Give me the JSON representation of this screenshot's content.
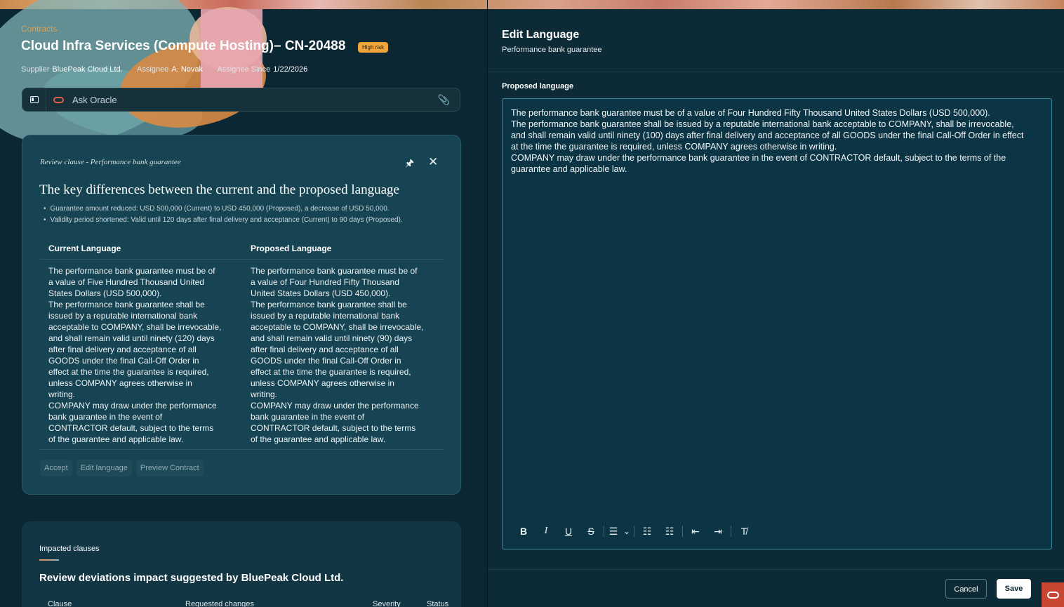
{
  "colors": {
    "accent_orange": "#f0a43c",
    "oracle_red": "#c74634",
    "panel_bg": "#0d2b36"
  },
  "contract": {
    "breadcrumb": "Contracts",
    "title": "Cloud Infra Services (Compute Hosting)– CN-20488",
    "risk_badge": "High risk",
    "supplier_label": "Supplier",
    "supplier_value": "BluePeak Cloud Ltd.",
    "assignee_label": "Assignee",
    "assignee_value": "A. Novak",
    "since_label": "Assignee Since",
    "since_value": "1/22/2026"
  },
  "ask": {
    "placeholder": "Ask Oracle",
    "panel_icon": "panel-toggle-icon",
    "clip_icon": "paperclip-icon"
  },
  "review": {
    "subtitle": "Review clause - Performance bank guarantee",
    "heading": "The key differences between the current and the proposed language",
    "bullets": [
      "Guarantee amount reduced: USD 500,000 (Current) to USD 450,000 (Proposed), a decrease of USD 50,000.",
      "Validity period shortened: Valid until 120 days after final delivery and acceptance (Current) to 90 days (Proposed)."
    ],
    "current_header": "Current Language",
    "proposed_header": "Proposed Language",
    "current_text": "The performance bank guarantee must be of\na value of Five Hundred Thousand United\nStates Dollars (USD 500,000).\nThe performance bank guarantee shall be\nissued by a reputable international bank\nacceptable to COMPANY, shall be irrevocable,\nand shall remain valid until ninety (120) days\nafter final delivery and acceptance of all\nGOODS under the final Call-Off Order in\neffect at the time the guarantee is required,\nunless COMPANY agrees otherwise in\nwriting.\nCOMPANY may draw under the performance\nbank guarantee in the event of\nCONTRACTOR default, subject to the terms\nof the guarantee and applicable law.",
    "proposed_text": "The performance bank guarantee must be of\na value of Four Hundred Fifty Thousand\nUnited States Dollars (USD 450,000).\nThe performance bank guarantee shall be\nissued by a reputable international bank\nacceptable to COMPANY, shall be irrevocable,\nand shall remain valid until ninety (90) days\nafter final delivery and acceptance of all\nGOODS under the final Call-Off Order in\neffect at the time the guarantee is required,\nunless COMPANY agrees otherwise in\nwriting.\nCOMPANY may draw under the performance\nbank guarantee in the event of\nCONTRACTOR default, subject to the terms\nof the guarantee and applicable law.",
    "actions": [
      "Accept",
      "Edit language",
      "Preview Contract"
    ]
  },
  "impacted": {
    "label": "Impacted clauses",
    "heading": "Review deviations impact suggested by BluePeak Cloud Ltd.",
    "columns": [
      "Clause",
      "Requested changes",
      "Severity",
      "Status"
    ]
  },
  "edit": {
    "title": "Edit Language",
    "subtitle": "Performance bank guarantee",
    "field_label": "Proposed language",
    "text": "The performance bank guarantee must be of a value of Four Hundred Fifty Thousand United States Dollars (USD 500,000).\nThe performance bank guarantee shall be issued by a reputable international bank acceptable to COMPANY, shall be irrevocable,\nand shall remain valid until ninety (100) days after final delivery and acceptance of all GOODS under the final Call-Off Order in effect\nat the time the guarantee is required, unless COMPANY agrees otherwise in writing.\nCOMPANY may draw under the performance bank guarantee in the event of CONTRACTOR default, subject to the terms of the\nguarantee and applicable law.",
    "toolbar": {
      "bold": "B",
      "italic": "I",
      "underline": "U",
      "strike": "S",
      "align": "☰",
      "dropdown": "⌄",
      "bullets": "☷",
      "numbered": "☷",
      "outdent": "⇤",
      "indent": "⇥",
      "clear": "T̸"
    },
    "cancel": "Cancel",
    "save": "Save"
  }
}
